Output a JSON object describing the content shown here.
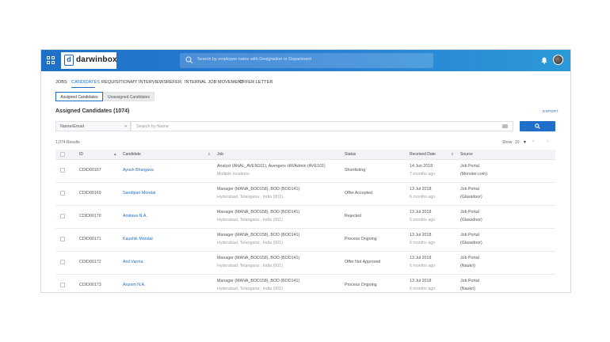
{
  "header": {
    "logo_text": "darwinbox",
    "logo_letter": "d",
    "search_placeholder": "Search by employee name with Designation or Department"
  },
  "nav": {
    "tabs": [
      "JOBS",
      "CANDIDATES",
      "REQUISITION",
      "MY INTERVIEWS",
      "REFER",
      "INTERNAL JOB MOVEMENT",
      "OFFER LETTER"
    ],
    "active": "CANDIDATES"
  },
  "segments": {
    "assigned": "Assigned Candidates",
    "unassigned": "Unassigned Candidates"
  },
  "section": {
    "title": "Assigned Candidates (1074)",
    "export": "EXPORT"
  },
  "filter": {
    "select_value": "Name/Email",
    "search_placeholder": "Search by Name"
  },
  "pagination": {
    "results": "1,074 Results",
    "show_label": "Show",
    "show_value": "10",
    "prev": "‹",
    "next": "›"
  },
  "table": {
    "columns": [
      "ID",
      "Candidate",
      "Job",
      "Status",
      "Received Date",
      "Source"
    ],
    "rows": [
      {
        "id": "CDID00167",
        "candidate": "Ayush Bhargava",
        "job": "Analyst (ANAL_AVEN101), Avengers HR/Admin (AVE101)",
        "location": "Multiple locations",
        "status": "Shortlisting",
        "date": "14 Jun 2018",
        "ago": "7 months ago",
        "source": "Job Portal",
        "source_detail": "(Monster.com)"
      },
      {
        "id": "CDID00169",
        "candidate": "Sandipan Mondal",
        "job": "Manager (MANA_BOD158), BOD (BOD141)",
        "location": "Hyderabad, Telangana , India (001)",
        "status": "Offer Accepted",
        "date": "13 Jul 2018",
        "ago": "6 months ago",
        "source": "Job Portal",
        "source_detail": "(Glassdoor)"
      },
      {
        "id": "CDID00170",
        "candidate": "Amitava N.A.",
        "job": "Manager (MANA_BOD158), BOD (BOD141)",
        "location": "Hyderabad, Telangana , India (001)",
        "status": "Rejected",
        "date": "13 Jul 2018",
        "ago": "6 months ago",
        "source": "Job Portal",
        "source_detail": "(Glassdoor)"
      },
      {
        "id": "CDID00171",
        "candidate": "Kaushik Mondal",
        "job": "Manager (MANA_BOD158), BOD (BOD141)",
        "location": "Hyderabad, Telangana , India (001)",
        "status": "Process Ongoing",
        "date": "13 Jul 2018",
        "ago": "6 months ago",
        "source": "Job Portal",
        "source_detail": "(Glassdoor)"
      },
      {
        "id": "CDID00172",
        "candidate": "Anil Varma",
        "job": "Manager (MANA_BOD158), BOD (BOD141)",
        "location": "Hyderabad, Telangana , India (001)",
        "status": "Offer Not Approved",
        "date": "13 Jul 2018",
        "ago": "6 months ago",
        "source": "Job Portal",
        "source_detail": "(Naukri)"
      },
      {
        "id": "CDID00173",
        "candidate": "Arunim N.A.",
        "job": "Manager (MANA_BOD158), BOD (BOD141)",
        "location": "Hyderabad, Telangana , India (001)",
        "status": "Process Ongoing",
        "date": "13 Jul 2018",
        "ago": "6 months ago",
        "source": "Job Portal",
        "source_detail": "(Naukri)"
      }
    ]
  },
  "colors": {
    "brand_blue": "#1f6fc9",
    "header_gradient_end": "#2b9ad8",
    "link": "#1f6fc9"
  },
  "icons": {
    "apps": "grid-icon",
    "search": "search-icon",
    "notifications": "bell-icon",
    "sort": "sort-icon",
    "prev": "chevron-left-icon",
    "next": "chevron-right-icon",
    "keyboard": "keyboard-icon",
    "caret": "caret-down-icon"
  }
}
